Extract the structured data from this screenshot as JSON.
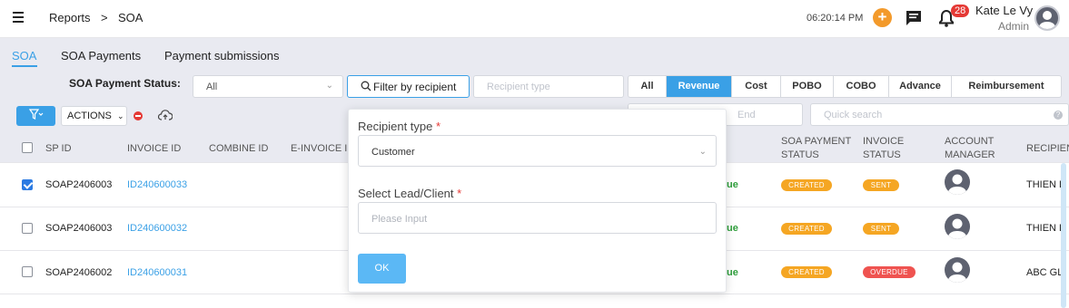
{
  "header": {
    "breadcrumb": [
      "Reports",
      ">",
      "SOA"
    ],
    "time": "06:20:14 PM",
    "notification_count": "28",
    "user_name": "Kate Le Vy",
    "user_role": "Admin",
    "icons": [
      "hamburger-icon",
      "plus-icon",
      "chat-icon",
      "bell-icon",
      "user-avatar"
    ]
  },
  "tabs": [
    "SOA",
    "SOA Payments",
    "Payment submissions"
  ],
  "filters": {
    "status_label": "SOA Payment Status:",
    "status_value": "All",
    "filter_by_recipient": "Filter by recipient",
    "recipient_type_placeholder": "Recipient type",
    "segments": [
      "All",
      "Revenue",
      "Cost",
      "POBO",
      "COBO",
      "Advance",
      "Reimbursement"
    ],
    "active_segment": "Revenue",
    "actions_label": "ACTIONS",
    "date_end_placeholder": "End",
    "quick_search_placeholder": "Quick search"
  },
  "table": {
    "columns": {
      "sp_id": "SP ID",
      "invoice_id": "INVOICE ID",
      "combine_id": "COMBINE ID",
      "einvoice": "E-INVOICE I",
      "soa_payment_status": [
        "SOA PAYMENT",
        "STATUS"
      ],
      "invoice_status": [
        "INVOICE",
        "STATUS"
      ],
      "account_manager": [
        "ACCOUNT",
        "MANAGER"
      ],
      "recipient": "RECIPIEN"
    },
    "rows": [
      {
        "checked": true,
        "sp_id": "SOAP2406003",
        "invoice_id": "ID240600033",
        "type": "ue",
        "soa_status": "CREATED",
        "invoice_status": "SENT",
        "recipient": "THIEN L"
      },
      {
        "checked": false,
        "sp_id": "SOAP2406003",
        "invoice_id": "ID240600032",
        "type": "ue",
        "soa_status": "CREATED",
        "invoice_status": "SENT",
        "recipient": "THIEN L"
      },
      {
        "checked": false,
        "sp_id": "SOAP2406002",
        "invoice_id": "ID240600031",
        "type": "ue",
        "soa_status": "CREATED",
        "invoice_status": "OVERDUE",
        "recipient": "ABC GL"
      }
    ]
  },
  "popup": {
    "recipient_type_label": "Recipient type",
    "recipient_type_value": "Customer",
    "lead_label": "Select Lead/Client",
    "lead_placeholder": "Please Input",
    "required_mark": "*",
    "ok_label": "OK"
  },
  "colors": {
    "accent": "#3aa0e6",
    "background_gray": "#e9eaf1",
    "created": "#f5a623",
    "overdue": "#ef5350",
    "revenue_text": "#2e9e3b"
  }
}
